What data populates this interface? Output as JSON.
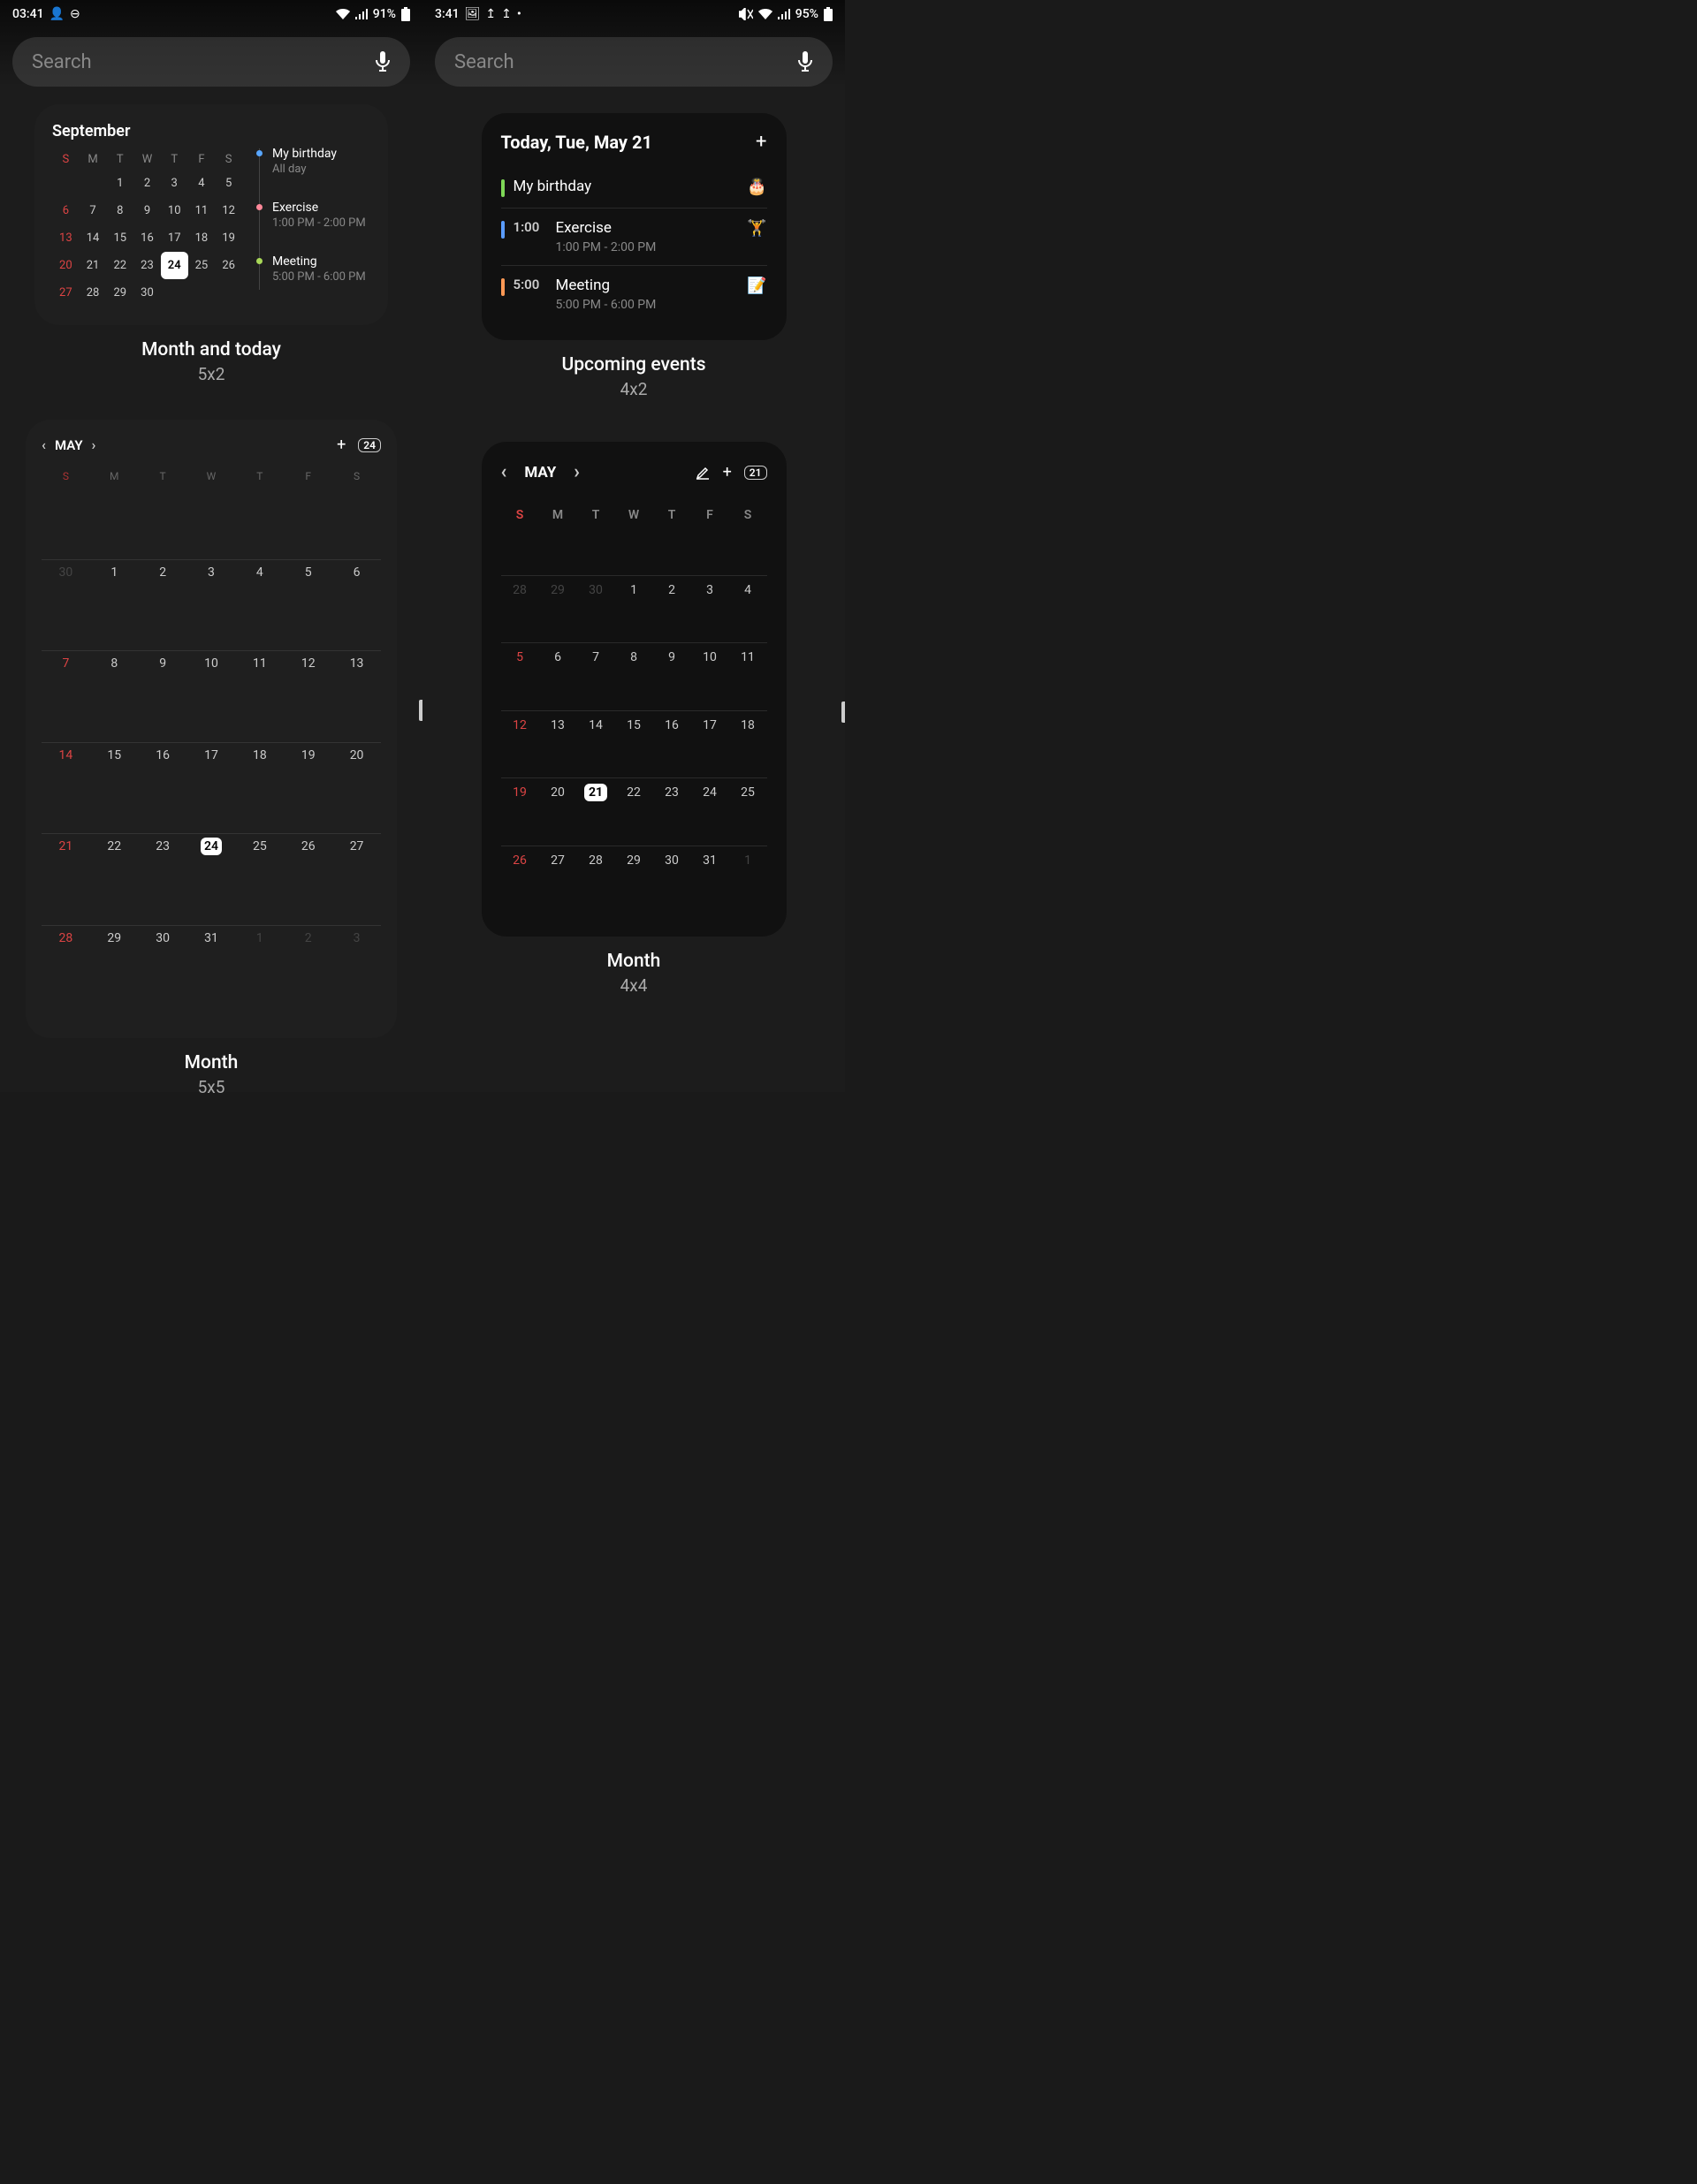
{
  "left": {
    "status": {
      "time": "03:41",
      "battery": "91%"
    },
    "search_placeholder": "Search",
    "w1": {
      "month": "September",
      "days_hd": [
        "S",
        "M",
        "T",
        "W",
        "T",
        "F",
        "S"
      ],
      "weeks": [
        [
          "",
          "",
          "1",
          "2",
          "3",
          "4",
          "5"
        ],
        [
          "6",
          "7",
          "8",
          "9",
          "10",
          "11",
          "12"
        ],
        [
          "13",
          "14",
          "15",
          "16",
          "17",
          "18",
          "19"
        ],
        [
          "20",
          "21",
          "22",
          "23",
          "24",
          "25",
          "26"
        ],
        [
          "27",
          "28",
          "29",
          "30",
          "",
          "",
          ""
        ]
      ],
      "today": "24",
      "events": [
        {
          "title": "My birthday",
          "time": "All day",
          "dot": "blue"
        },
        {
          "title": "Exercise",
          "time": "1:00 PM - 2:00 PM",
          "dot": "pink"
        },
        {
          "title": "Meeting",
          "time": "5:00 PM - 6:00 PM",
          "dot": "green"
        }
      ],
      "label": "Month and today",
      "size": "5x2"
    },
    "w2": {
      "month": "MAY",
      "chip": "24",
      "days_hd": [
        "S",
        "M",
        "T",
        "W",
        "T",
        "F",
        "S"
      ],
      "weeks": [
        [
          {
            "d": "30",
            "dim": true
          },
          {
            "d": "1"
          },
          {
            "d": "2"
          },
          {
            "d": "3"
          },
          {
            "d": "4"
          },
          {
            "d": "5"
          },
          {
            "d": "6"
          }
        ],
        [
          {
            "d": "7"
          },
          {
            "d": "8"
          },
          {
            "d": "9"
          },
          {
            "d": "10"
          },
          {
            "d": "11"
          },
          {
            "d": "12"
          },
          {
            "d": "13"
          }
        ],
        [
          {
            "d": "14"
          },
          {
            "d": "15"
          },
          {
            "d": "16"
          },
          {
            "d": "17"
          },
          {
            "d": "18"
          },
          {
            "d": "19"
          },
          {
            "d": "20"
          }
        ],
        [
          {
            "d": "21"
          },
          {
            "d": "22"
          },
          {
            "d": "23"
          },
          {
            "d": "24",
            "today": true
          },
          {
            "d": "25"
          },
          {
            "d": "26"
          },
          {
            "d": "27"
          }
        ],
        [
          {
            "d": "28"
          },
          {
            "d": "29"
          },
          {
            "d": "30"
          },
          {
            "d": "31"
          },
          {
            "d": "1",
            "dim": true
          },
          {
            "d": "2",
            "dim": true
          },
          {
            "d": "3",
            "dim": true
          }
        ]
      ],
      "label": "Month",
      "size": "5x5"
    }
  },
  "right": {
    "status": {
      "time": "3:41",
      "battery": "95%"
    },
    "search_placeholder": "Search",
    "w3": {
      "title": "Today, Tue, May 21",
      "events": [
        {
          "bar": "green",
          "time": "",
          "title": "My birthday",
          "sub": "",
          "emoji": "🎂"
        },
        {
          "bar": "blue",
          "time": "1:00",
          "title": "Exercise",
          "sub": "1:00 PM - 2:00 PM",
          "emoji": "🏋️"
        },
        {
          "bar": "orange",
          "time": "5:00",
          "title": "Meeting",
          "sub": "5:00 PM - 6:00 PM",
          "emoji": "📝"
        }
      ],
      "label": "Upcoming events",
      "size": "4x2"
    },
    "w4": {
      "month": "MAY",
      "chip": "21",
      "days_hd": [
        "S",
        "M",
        "T",
        "W",
        "T",
        "F",
        "S"
      ],
      "weeks": [
        [
          {
            "d": "28",
            "dim": true
          },
          {
            "d": "29",
            "dim": true
          },
          {
            "d": "30",
            "dim": true
          },
          {
            "d": "1"
          },
          {
            "d": "2"
          },
          {
            "d": "3"
          },
          {
            "d": "4"
          }
        ],
        [
          {
            "d": "5"
          },
          {
            "d": "6"
          },
          {
            "d": "7"
          },
          {
            "d": "8"
          },
          {
            "d": "9"
          },
          {
            "d": "10"
          },
          {
            "d": "11"
          }
        ],
        [
          {
            "d": "12"
          },
          {
            "d": "13"
          },
          {
            "d": "14"
          },
          {
            "d": "15"
          },
          {
            "d": "16"
          },
          {
            "d": "17"
          },
          {
            "d": "18"
          }
        ],
        [
          {
            "d": "19"
          },
          {
            "d": "20"
          },
          {
            "d": "21",
            "today": true
          },
          {
            "d": "22"
          },
          {
            "d": "23"
          },
          {
            "d": "24"
          },
          {
            "d": "25"
          }
        ],
        [
          {
            "d": "26"
          },
          {
            "d": "27"
          },
          {
            "d": "28"
          },
          {
            "d": "29"
          },
          {
            "d": "30"
          },
          {
            "d": "31"
          },
          {
            "d": "1",
            "dim": true
          }
        ]
      ],
      "label": "Month",
      "size": "4x4"
    }
  }
}
